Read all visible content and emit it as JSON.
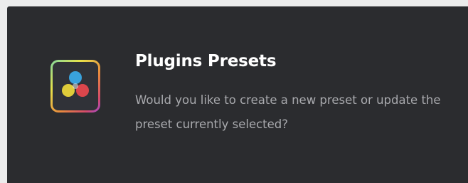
{
  "dialog": {
    "title": "Plugins Presets",
    "message": "Would you like to create a new preset or update the preset currently selected?",
    "app_icon": "davinci-resolve-icon"
  },
  "colors": {
    "dialog_background": "#2b2c2f",
    "title_text": "#ffffff",
    "message_text": "#a9aaae",
    "icon_blue": "#3aa9e6",
    "icon_yellow": "#e9d53a",
    "icon_red": "#e5484d"
  }
}
